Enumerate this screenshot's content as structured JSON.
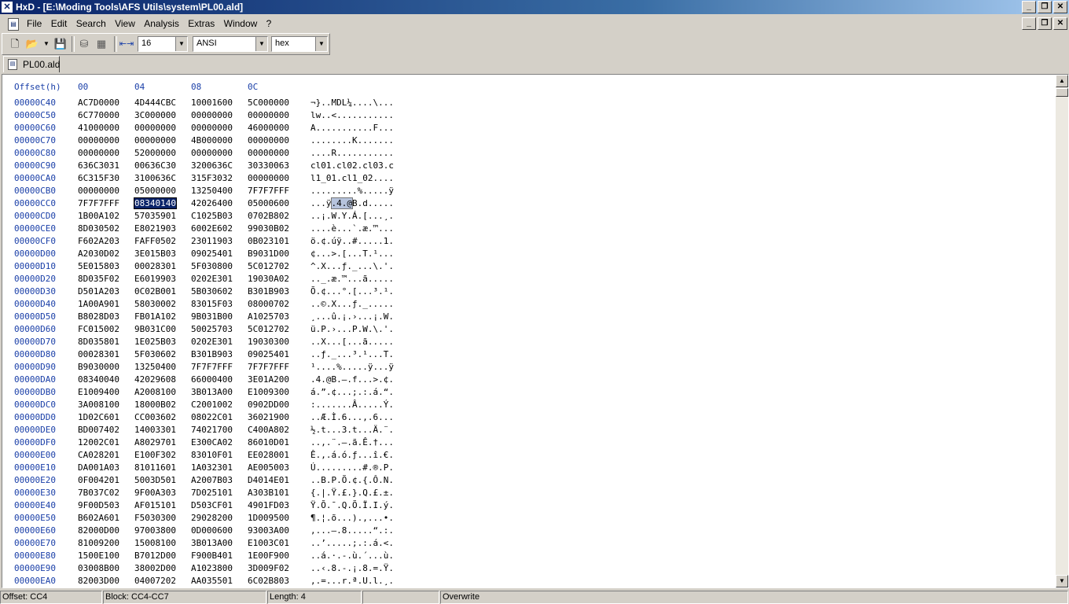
{
  "window": {
    "title": "HxD - [E:\\Moding Tools\\AFS Utils\\system\\PL00.ald]",
    "app_icon": "hxd-logo-icon"
  },
  "menu": {
    "items": [
      "File",
      "Edit",
      "Search",
      "View",
      "Analysis",
      "Extras",
      "Window",
      "?"
    ]
  },
  "toolbar": {
    "bytes_per_row": "16",
    "charset": "ANSI",
    "offset_base": "hex",
    "icons": [
      "new-file-icon",
      "open-file-icon",
      "save-icon",
      "disk-icon",
      "ram-icon",
      "bytes-per-row-icon"
    ]
  },
  "tabs": [
    {
      "label": "PL00.ald",
      "icon": "document-icon"
    }
  ],
  "editor": {
    "header": {
      "offset": "Offset(h)",
      "cols": [
        "00",
        "04",
        "08",
        "0C"
      ]
    },
    "rows": [
      {
        "offset": "00000C40",
        "groups": [
          "AC7D0000",
          "4D444CBC",
          "10001600",
          "5C000000"
        ],
        "text": "¬}..MDL¼....\\..."
      },
      {
        "offset": "00000C50",
        "groups": [
          "6C770000",
          "3C000000",
          "00000000",
          "00000000"
        ],
        "text": "lw..<..........."
      },
      {
        "offset": "00000C60",
        "groups": [
          "41000000",
          "00000000",
          "00000000",
          "46000000"
        ],
        "text": "A...........F..."
      },
      {
        "offset": "00000C70",
        "groups": [
          "00000000",
          "00000000",
          "4B000000",
          "00000000"
        ],
        "text": "........K......."
      },
      {
        "offset": "00000C80",
        "groups": [
          "00000000",
          "52000000",
          "00000000",
          "00000000"
        ],
        "text": "....R..........."
      },
      {
        "offset": "00000C90",
        "groups": [
          "636C3031",
          "00636C30",
          "3200636C",
          "30330063"
        ],
        "text": "cl01.cl02.cl03.c"
      },
      {
        "offset": "00000CA0",
        "groups": [
          "6C315F30",
          "3100636C",
          "315F3032",
          "00000000"
        ],
        "text": "l1_01.cl1_02...."
      },
      {
        "offset": "00000CB0",
        "groups": [
          "00000000",
          "05000000",
          "13250400",
          "7F7F7FFF"
        ],
        "text": ".........%.....ÿ"
      },
      {
        "offset": "00000CC0",
        "groups": [
          "7F7F7FFF",
          "08340140",
          "42026400",
          "05000600"
        ],
        "text": "...ÿ.4.@B.d....."
      },
      {
        "offset": "00000CD0",
        "groups": [
          "1B00A102",
          "57035901",
          "C1025B03",
          "0702B802"
        ],
        "text": "..¡.W.Y.Á.[...¸."
      },
      {
        "offset": "00000CE0",
        "groups": [
          "8D030502",
          "E8021903",
          "6002E602",
          "99030B02"
        ],
        "text": "....è...`.æ.™..."
      },
      {
        "offset": "00000CF0",
        "groups": [
          "F602A203",
          "FAFF0502",
          "23011903",
          "0B023101"
        ],
        "text": "ö.¢.úÿ..#.....1."
      },
      {
        "offset": "00000D00",
        "groups": [
          "A2030D02",
          "3E015B03",
          "09025401",
          "B9031D00"
        ],
        "text": "¢...>.[...T.¹..."
      },
      {
        "offset": "00000D10",
        "groups": [
          "5E015803",
          "00028301",
          "5F030800",
          "5C012702"
        ],
        "text": "^.X...ƒ._...\\.'."
      },
      {
        "offset": "00000D20",
        "groups": [
          "8D035F02",
          "E6019903",
          "0202E301",
          "19030A02"
        ],
        "text": ".._.æ.™...ã....."
      },
      {
        "offset": "00000D30",
        "groups": [
          "D501A203",
          "0C02B001",
          "5B030602",
          "B301B903"
        ],
        "text": "Õ.¢...°.[...³.¹."
      },
      {
        "offset": "00000D40",
        "groups": [
          "1A00A901",
          "58030002",
          "83015F03",
          "08000702"
        ],
        "text": "..©.X...ƒ._....."
      },
      {
        "offset": "00000D50",
        "groups": [
          "B8028D03",
          "FB01A102",
          "9B031B00",
          "A1025703"
        ],
        "text": "¸...û.¡.›...¡.W."
      },
      {
        "offset": "00000D60",
        "groups": [
          "FC015002",
          "9B031C00",
          "50025703",
          "5C012702"
        ],
        "text": "ü.P.›...P.W.\\.'."
      },
      {
        "offset": "00000D70",
        "groups": [
          "8D035801",
          "1E025B03",
          "0202E301",
          "19030300"
        ],
        "text": "..X...[...ã....."
      },
      {
        "offset": "00000D80",
        "groups": [
          "00028301",
          "5F030602",
          "B301B903",
          "09025401"
        ],
        "text": "..ƒ._...³.¹...T."
      },
      {
        "offset": "00000D90",
        "groups": [
          "B9030000",
          "13250400",
          "7F7F7FFF",
          "7F7F7FFF"
        ],
        "text": "¹....%.....ÿ...ÿ"
      },
      {
        "offset": "00000DA0",
        "groups": [
          "08340040",
          "42029608",
          "66000400",
          "3E01A200"
        ],
        "text": ".4.@B.–.f...>.¢."
      },
      {
        "offset": "00000DB0",
        "groups": [
          "E1009400",
          "A2008100",
          "3B013A00",
          "E1009300"
        ],
        "text": "á.”.¢...;.:.á.“."
      },
      {
        "offset": "00000DC0",
        "groups": [
          "3A008100",
          "18000B02",
          "C2001002",
          "0902DD00"
        ],
        "text": ":.......Â.....Ý."
      },
      {
        "offset": "00000DD0",
        "groups": [
          "1D02C601",
          "CC003602",
          "08022C01",
          "36021900"
        ],
        "text": "..Æ.Ì.6...,.6..."
      },
      {
        "offset": "00000DE0",
        "groups": [
          "BD007402",
          "14003301",
          "74021700",
          "C400A802"
        ],
        "text": "½.t...3.t...Ä.¨."
      },
      {
        "offset": "00000DF0",
        "groups": [
          "12002C01",
          "A8029701",
          "E300CA02",
          "86010D01"
        ],
        "text": "..,.¨.—.ã.Ê.†..."
      },
      {
        "offset": "00000E00",
        "groups": [
          "CA028201",
          "E100F302",
          "83010F01",
          "EE028001"
        ],
        "text": "Ê.‚.á.ó.ƒ...î.€."
      },
      {
        "offset": "00000E10",
        "groups": [
          "DA001A03",
          "81011601",
          "1A032301",
          "AE005003"
        ],
        "text": "Ú.........#.®.P."
      },
      {
        "offset": "00000E20",
        "groups": [
          "0F004201",
          "5003D501",
          "A2007B03",
          "D4014E01"
        ],
        "text": "..B.P.Õ.¢.{.Ô.N."
      },
      {
        "offset": "00000E30",
        "groups": [
          "7B037C02",
          "9F00A303",
          "7D025101",
          "A303B101"
        ],
        "text": "{.|.Ÿ.£.}.Q.£.±."
      },
      {
        "offset": "00000E40",
        "groups": [
          "9F00D503",
          "AF015101",
          "D503CF01",
          "4901FD03"
        ],
        "text": "Ÿ.Õ.¯.Q.Õ.Ï.I.ý."
      },
      {
        "offset": "00000E50",
        "groups": [
          "B602A601",
          "F5030300",
          "29028200",
          "1D009500"
        ],
        "text": "¶.¦.õ...).‚...•."
      },
      {
        "offset": "00000E60",
        "groups": [
          "82000D00",
          "97003800",
          "0D000600",
          "93003A00"
        ],
        "text": "‚...—.8.....“.:."
      },
      {
        "offset": "00000E70",
        "groups": [
          "81009200",
          "15008100",
          "3B013A00",
          "E1003C01"
        ],
        "text": "..’.....;.:.á.<."
      },
      {
        "offset": "00000E80",
        "groups": [
          "1500E100",
          "B7012D00",
          "F900B401",
          "1E00F900"
        ],
        "text": "..á.·.-.ù.´...ù."
      },
      {
        "offset": "00000E90",
        "groups": [
          "03008B00",
          "38002D00",
          "A1023800",
          "3D009F02"
        ],
        "text": "..‹.8.-.¡.8.=.Ÿ."
      },
      {
        "offset": "00000EA0",
        "groups": [
          "82003D00",
          "04007202",
          "AA035501",
          "6C02B803"
        ],
        "text": "‚.=...r.ª.U.l.¸."
      }
    ]
  },
  "statusbar": {
    "offset": "Offset: CC4",
    "block": "Block: CC4-CC7",
    "length": "Length: 4",
    "mode": "Overwrite"
  }
}
